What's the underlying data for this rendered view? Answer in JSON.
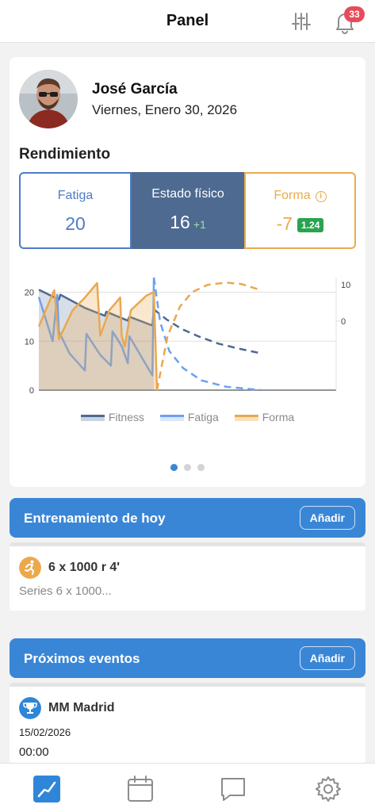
{
  "header": {
    "title": "Panel",
    "notification_count": "33"
  },
  "profile": {
    "name": "José García",
    "date": "Viernes, Enero 30, 2026"
  },
  "performance": {
    "title": "Rendimiento",
    "fatiga": {
      "label": "Fatiga",
      "value": "20"
    },
    "estado": {
      "label": "Estado físico",
      "value": "16",
      "delta": "+1"
    },
    "forma": {
      "label": "Forma",
      "value": "-7",
      "ratio": "1.24"
    }
  },
  "chart_data": {
    "type": "line",
    "left_axis": {
      "ticks": [
        "0",
        "10",
        "20"
      ],
      "range": [
        0,
        23
      ]
    },
    "right_axis": {
      "ticks": [
        "0",
        "10"
      ],
      "range": [
        -19,
        12
      ]
    },
    "x_domain": [
      0,
      100
    ],
    "series": [
      {
        "name": "Fitness",
        "color": "#4e6a91",
        "fill": true,
        "points": [
          [
            0,
            20.5
          ],
          [
            13,
            18.5
          ],
          [
            14,
            19.5
          ],
          [
            30,
            16.8
          ],
          [
            43,
            15.2
          ],
          [
            44,
            16
          ],
          [
            58,
            14.2
          ],
          [
            59,
            15
          ],
          [
            74,
            13.2
          ],
          [
            75,
            16.5
          ]
        ],
        "projected": [
          [
            75,
            16.5
          ],
          [
            83,
            14.5
          ],
          [
            93,
            12.5
          ],
          [
            104,
            11
          ],
          [
            117,
            9.5
          ],
          [
            130,
            8.5
          ],
          [
            145,
            7.5
          ]
        ]
      },
      {
        "name": "Fatiga",
        "color": "#6ea0ec",
        "fill": false,
        "points": [
          [
            0,
            19
          ],
          [
            9,
            10
          ],
          [
            12,
            19.5
          ],
          [
            13,
            12
          ],
          [
            20,
            7.5
          ],
          [
            30,
            4
          ],
          [
            31,
            11.5
          ],
          [
            40,
            7.2
          ],
          [
            47,
            5
          ],
          [
            48,
            12
          ],
          [
            54,
            9
          ],
          [
            58,
            5.5
          ],
          [
            59,
            11
          ],
          [
            74,
            3
          ],
          [
            75,
            23
          ]
        ],
        "projected": [
          [
            75,
            23
          ],
          [
            79,
            14
          ],
          [
            85,
            8
          ],
          [
            94,
            4.5
          ],
          [
            106,
            2
          ],
          [
            122,
            0.7
          ],
          [
            145,
            0
          ]
        ]
      },
      {
        "name": "Forma",
        "color": "#eaa84e",
        "fill": true,
        "points": [
          [
            0,
            -1.5
          ],
          [
            10,
            8.5
          ],
          [
            13,
            -5
          ],
          [
            17,
            -1.5
          ],
          [
            22,
            3
          ],
          [
            30,
            6.5
          ],
          [
            38,
            10.5
          ],
          [
            40,
            -4
          ],
          [
            46,
            3
          ],
          [
            53,
            6.5
          ],
          [
            54,
            -4
          ],
          [
            56,
            -7
          ],
          [
            60,
            3
          ],
          [
            70,
            7
          ],
          [
            75,
            8
          ],
          [
            77,
            -19
          ]
        ],
        "projected": [
          [
            77,
            -19
          ],
          [
            84,
            -4
          ],
          [
            92,
            4
          ],
          [
            100,
            8
          ],
          [
            110,
            10
          ],
          [
            122,
            10.6
          ],
          [
            132,
            10.2
          ],
          [
            145,
            8.5
          ]
        ]
      }
    ]
  },
  "legend": {
    "fitness": "Fitness",
    "fatiga": "Fatiga",
    "forma": "Forma"
  },
  "training": {
    "title": "Entrenamiento de hoy",
    "add_label": "Añadir",
    "item_title": "6 x 1000 r 4'",
    "item_sub": "Series 6 x 1000..."
  },
  "events": {
    "title": "Próximos eventos",
    "add_label": "Añadir",
    "item_title": "MM Madrid",
    "item_date": "15/02/2026",
    "item_time": "00:00"
  },
  "nav": {
    "icons": [
      "chart-icon",
      "calendar-icon",
      "chat-icon",
      "settings-icon"
    ]
  }
}
